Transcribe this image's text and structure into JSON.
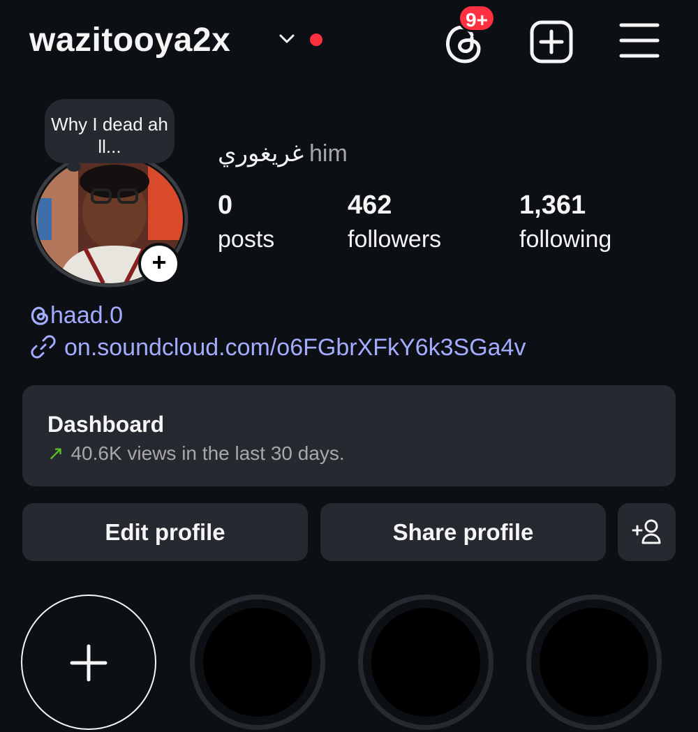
{
  "header": {
    "username": "wazitooya2x",
    "notification_badge": "9+",
    "dot_color": "#ff3040"
  },
  "profile": {
    "note": "Why I dead ah ll...",
    "full_name": "غريغوري",
    "pronouns": "him",
    "stats": [
      {
        "value": "0",
        "label": "posts"
      },
      {
        "value": "462",
        "label": "followers"
      },
      {
        "value": "1,361",
        "label": "following"
      }
    ],
    "threads_handle": "haad.0",
    "link": "on.soundcloud.com/o6FGbrXFkY6k3SGa4v"
  },
  "dashboard": {
    "title": "Dashboard",
    "arrow": "↗",
    "subtitle": "40.6K views in the last 30 days."
  },
  "actions": {
    "edit_label": "Edit profile",
    "share_label": "Share profile"
  },
  "colors": {
    "background": "#0c1014",
    "surface": "#262a30",
    "link": "#a4acff",
    "trend_up": "#58c322",
    "badge": "#ff3040"
  },
  "icons": [
    "chevron-down-icon",
    "threads-icon",
    "new-post-icon",
    "menu-icon",
    "link-icon",
    "discover-people-icon",
    "add-icon"
  ]
}
